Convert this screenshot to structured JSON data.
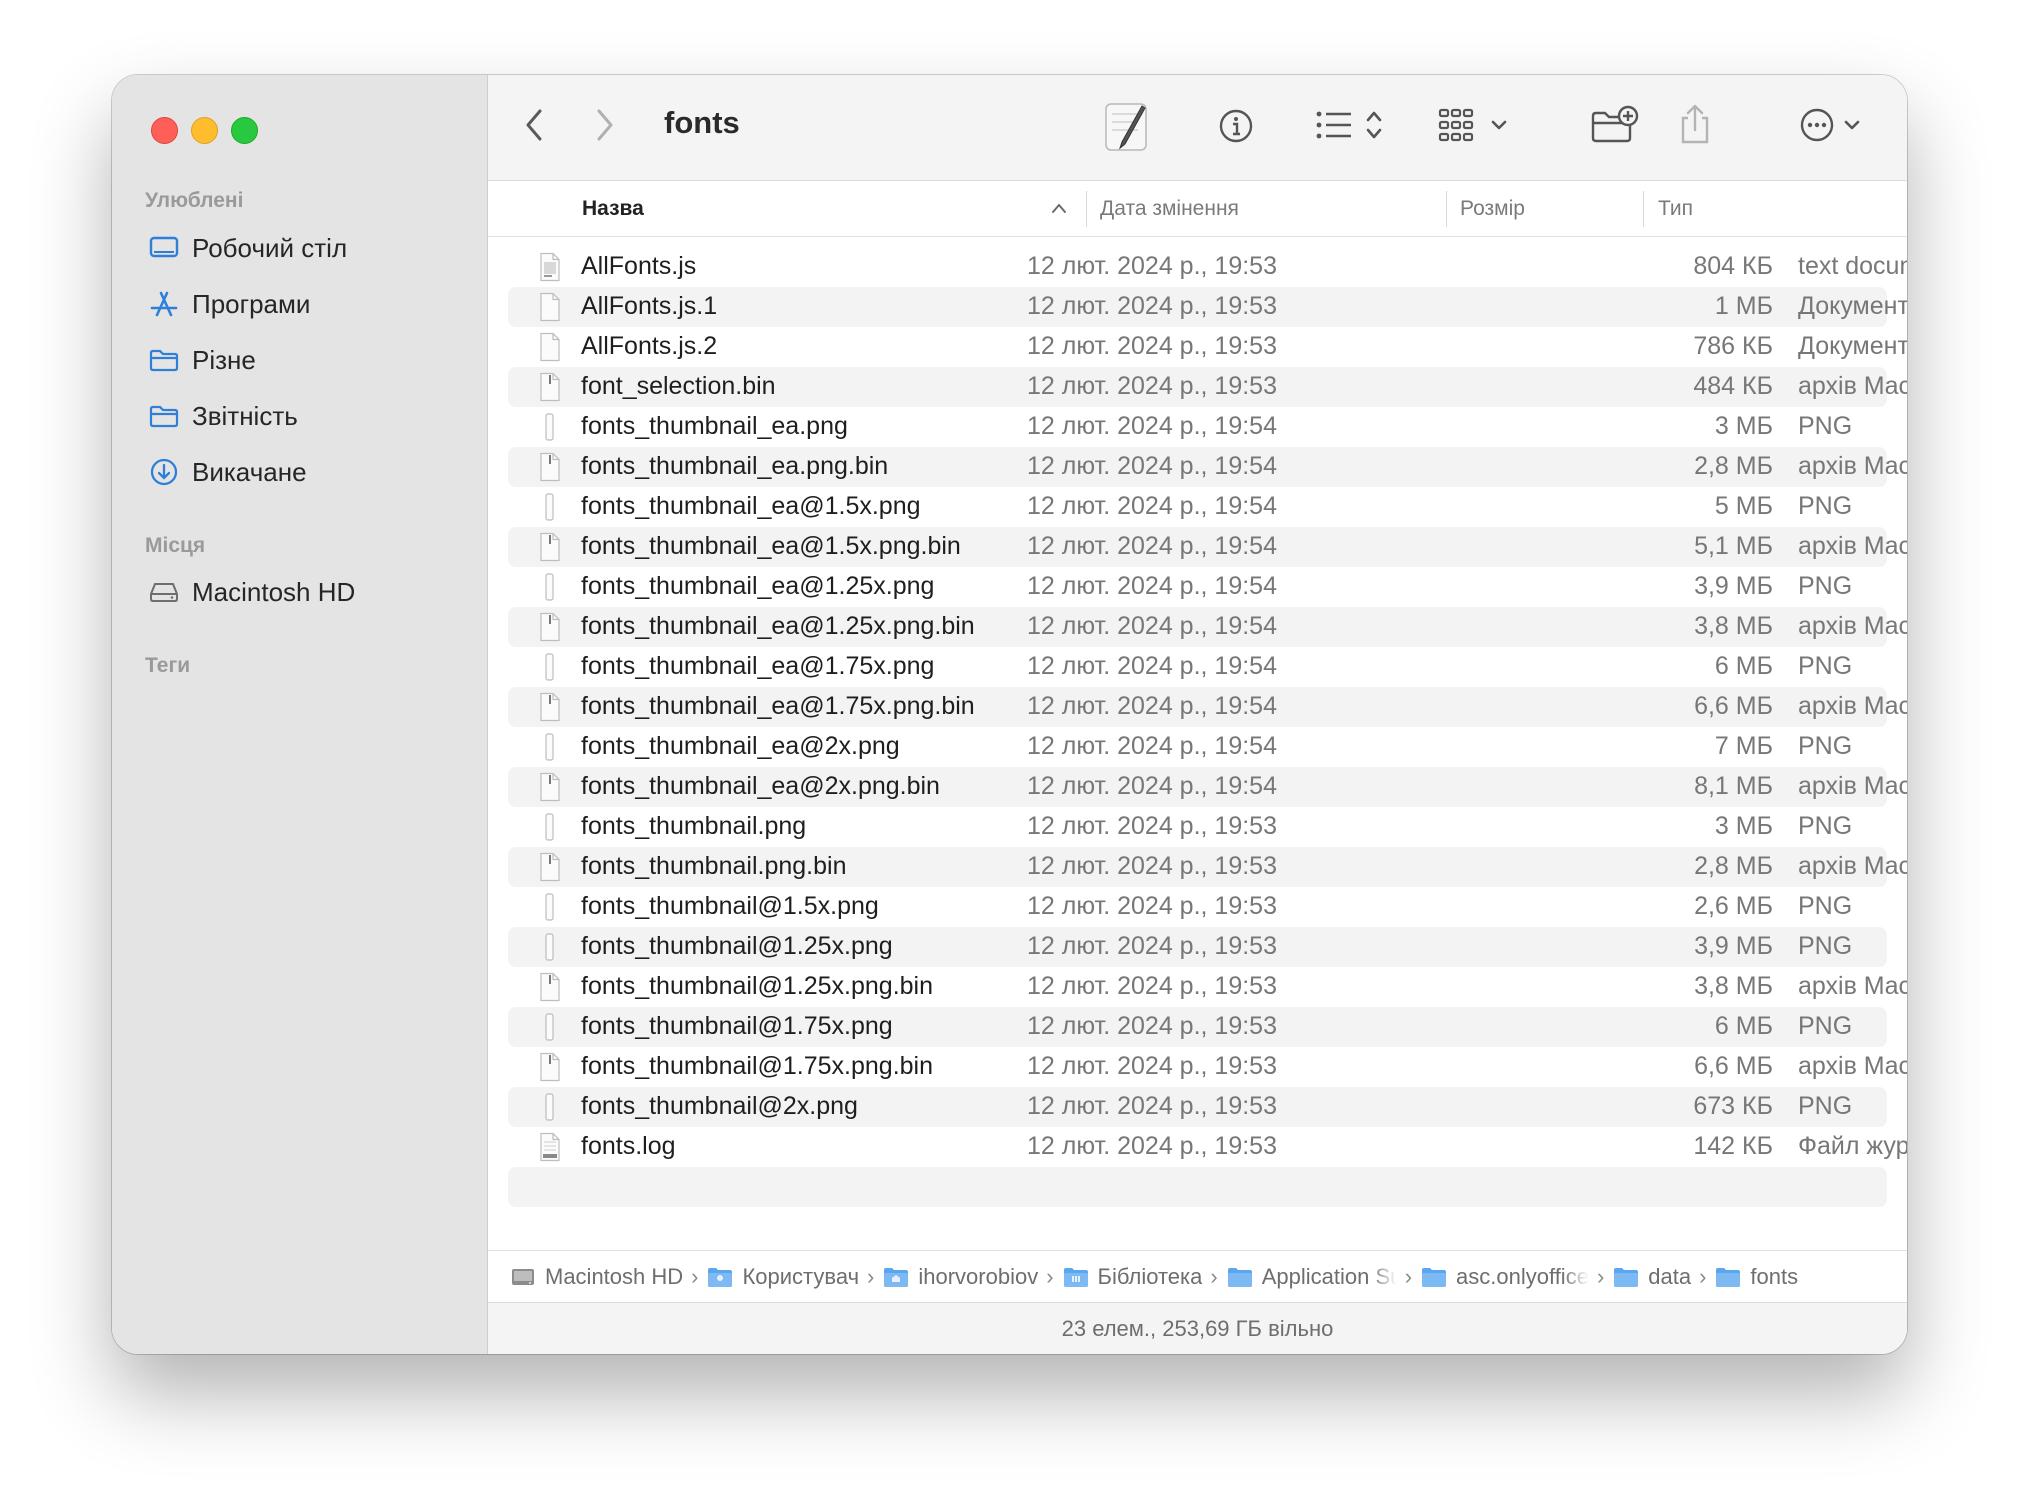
{
  "sidebar": {
    "favorites_header": "Улюблені",
    "favorites": [
      {
        "label": "Робочий стіл",
        "icon": "desktop-icon"
      },
      {
        "label": "Програми",
        "icon": "applications-icon"
      },
      {
        "label": "Різне",
        "icon": "folder-icon"
      },
      {
        "label": "Звітність",
        "icon": "folder-icon"
      },
      {
        "label": "Викачане",
        "icon": "downloads-icon"
      }
    ],
    "locations_header": "Місця",
    "locations": [
      {
        "label": "Macintosh HD",
        "icon": "disk-icon"
      }
    ],
    "tags_header": "Теги"
  },
  "toolbar": {
    "title": "fonts"
  },
  "columns": {
    "name": "Назва",
    "date": "Дата змінення",
    "size": "Розмір",
    "kind": "Тип"
  },
  "files": [
    {
      "name": "AllFonts.js",
      "date": "12 лют. 2024 р., 19:53",
      "size": "804 КБ",
      "kind": "text document",
      "icon": "js"
    },
    {
      "name": "AllFonts.js.1",
      "date": "12 лют. 2024 р., 19:53",
      "size": "1 МБ",
      "kind": "Документ",
      "icon": "doc"
    },
    {
      "name": "AllFonts.js.2",
      "date": "12 лют. 2024 р., 19:53",
      "size": "786 КБ",
      "kind": "Документ",
      "icon": "doc"
    },
    {
      "name": "font_selection.bin",
      "date": "12 лют. 2024 р., 19:53",
      "size": "484 КБ",
      "kind": "архів MacBinary",
      "icon": "bin"
    },
    {
      "name": "fonts_thumbnail_ea.png",
      "date": "12 лют. 2024 р., 19:54",
      "size": "3 МБ",
      "kind": "PNG",
      "icon": "png"
    },
    {
      "name": "fonts_thumbnail_ea.png.bin",
      "date": "12 лют. 2024 р., 19:54",
      "size": "2,8 МБ",
      "kind": "архів MacBinary",
      "icon": "bin"
    },
    {
      "name": "fonts_thumbnail_ea@1.5x.png",
      "date": "12 лют. 2024 р., 19:54",
      "size": "5 МБ",
      "kind": "PNG",
      "icon": "png"
    },
    {
      "name": "fonts_thumbnail_ea@1.5x.png.bin",
      "date": "12 лют. 2024 р., 19:54",
      "size": "5,1 МБ",
      "kind": "архів MacBinary",
      "icon": "bin"
    },
    {
      "name": "fonts_thumbnail_ea@1.25x.png",
      "date": "12 лют. 2024 р., 19:54",
      "size": "3,9 МБ",
      "kind": "PNG",
      "icon": "png"
    },
    {
      "name": "fonts_thumbnail_ea@1.25x.png.bin",
      "date": "12 лют. 2024 р., 19:54",
      "size": "3,8 МБ",
      "kind": "архів MacBinary",
      "icon": "bin"
    },
    {
      "name": "fonts_thumbnail_ea@1.75x.png",
      "date": "12 лют. 2024 р., 19:54",
      "size": "6 МБ",
      "kind": "PNG",
      "icon": "png"
    },
    {
      "name": "fonts_thumbnail_ea@1.75x.png.bin",
      "date": "12 лют. 2024 р., 19:54",
      "size": "6,6 МБ",
      "kind": "архів MacBinary",
      "icon": "bin"
    },
    {
      "name": "fonts_thumbnail_ea@2x.png",
      "date": "12 лют. 2024 р., 19:54",
      "size": "7 МБ",
      "kind": "PNG",
      "icon": "png"
    },
    {
      "name": "fonts_thumbnail_ea@2x.png.bin",
      "date": "12 лют. 2024 р., 19:54",
      "size": "8,1 МБ",
      "kind": "архів MacBinary",
      "icon": "bin"
    },
    {
      "name": "fonts_thumbnail.png",
      "date": "12 лют. 2024 р., 19:53",
      "size": "3 МБ",
      "kind": "PNG",
      "icon": "png"
    },
    {
      "name": "fonts_thumbnail.png.bin",
      "date": "12 лют. 2024 р., 19:53",
      "size": "2,8 МБ",
      "kind": "архів MacBinary",
      "icon": "bin"
    },
    {
      "name": "fonts_thumbnail@1.5x.png",
      "date": "12 лют. 2024 р., 19:53",
      "size": "2,6 МБ",
      "kind": "PNG",
      "icon": "png"
    },
    {
      "name": "fonts_thumbnail@1.25x.png",
      "date": "12 лют. 2024 р., 19:53",
      "size": "3,9 МБ",
      "kind": "PNG",
      "icon": "png"
    },
    {
      "name": "fonts_thumbnail@1.25x.png.bin",
      "date": "12 лют. 2024 р., 19:53",
      "size": "3,8 МБ",
      "kind": "архів MacBinary",
      "icon": "bin"
    },
    {
      "name": "fonts_thumbnail@1.75x.png",
      "date": "12 лют. 2024 р., 19:53",
      "size": "6 МБ",
      "kind": "PNG",
      "icon": "png"
    },
    {
      "name": "fonts_thumbnail@1.75x.png.bin",
      "date": "12 лют. 2024 р., 19:53",
      "size": "6,6 МБ",
      "kind": "архів MacBinary",
      "icon": "bin"
    },
    {
      "name": "fonts_thumbnail@2x.png",
      "date": "12 лют. 2024 р., 19:53",
      "size": "673 КБ",
      "kind": "PNG",
      "icon": "png"
    },
    {
      "name": "fonts.log",
      "date": "12 лют. 2024 р., 19:53",
      "size": "142 КБ",
      "kind": "Файл журналу",
      "icon": "log"
    }
  ],
  "path": [
    {
      "label": "Macintosh HD",
      "icon": "disk-icon"
    },
    {
      "label": "Користувач",
      "icon": "users-folder-icon"
    },
    {
      "label": "ihorvorobiov",
      "icon": "home-folder-icon"
    },
    {
      "label": "Бібліотека",
      "icon": "library-folder-icon"
    },
    {
      "label": "Application Support",
      "icon": "folder-icon"
    },
    {
      "label": "asc.onlyoffice",
      "icon": "folder-icon"
    },
    {
      "label": "data",
      "icon": "folder-icon"
    },
    {
      "label": "fonts",
      "icon": "folder-icon"
    }
  ],
  "status": "23 елем., 253,69 ГБ вільно",
  "colors": {
    "accent": "#2f7fd9",
    "close": "#ff5f57",
    "minimize": "#febc2e",
    "zoom": "#28c840"
  }
}
